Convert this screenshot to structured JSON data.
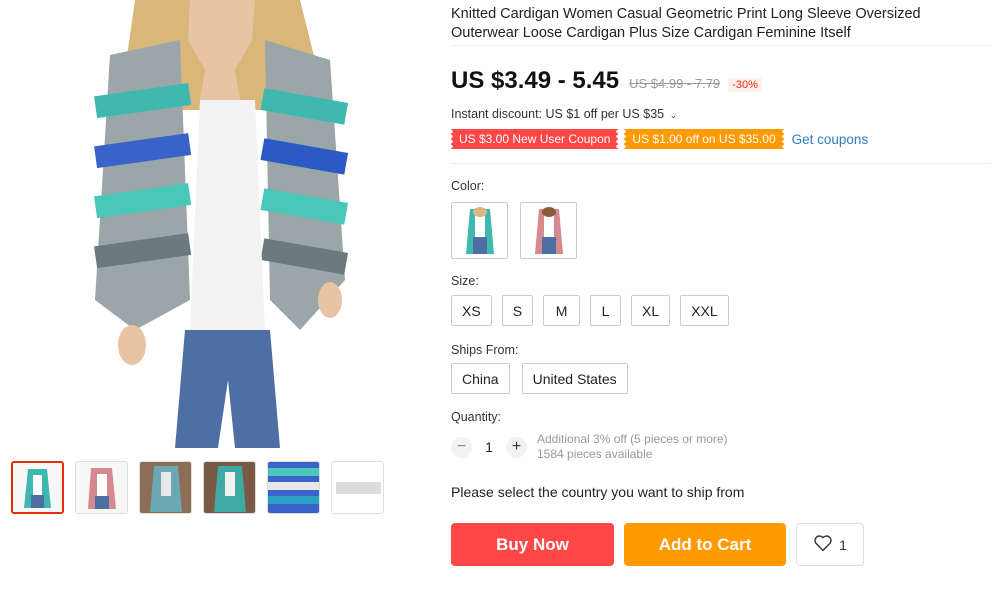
{
  "product": {
    "title": "Knitted Cardigan Women Casual Geometric Print Long Sleeve Oversized Outerwear Loose Cardigan Plus Size Cardigan Feminine Itself",
    "price": "US $3.49 - 5.45",
    "original_price": "US $4.99 - 7.79",
    "discount": "-30%",
    "instant_discount": "Instant discount: US $1 off per US $35"
  },
  "coupons": {
    "new_user": "US $3.00 New User Coupon",
    "spend_off": "US $1.00 off on US $35.00",
    "get_coupons": "Get coupons"
  },
  "color": {
    "label": "Color:"
  },
  "size": {
    "label": "Size:",
    "options": [
      "XS",
      "S",
      "M",
      "L",
      "XL",
      "XXL"
    ]
  },
  "ships_from": {
    "label": "Ships From:",
    "options": [
      "China",
      "United States"
    ]
  },
  "quantity": {
    "label": "Quantity:",
    "value": "1",
    "minus": "−",
    "plus": "+",
    "bulk_discount": "Additional 3% off (5 pieces or more)",
    "available": "1584 pieces available"
  },
  "ship_message": "Please select the country you want to ship from",
  "actions": {
    "buy_now": "Buy Now",
    "add_to_cart": "Add to Cart",
    "wishlist_count": "1"
  },
  "colors": {
    "accent_red": "#ff4747",
    "accent_orange": "#ff9a00",
    "link_blue": "#2e7dc1"
  },
  "icons": {
    "wishlist": "heart-icon",
    "instant_discount_expand": "chevron-down-icon"
  }
}
